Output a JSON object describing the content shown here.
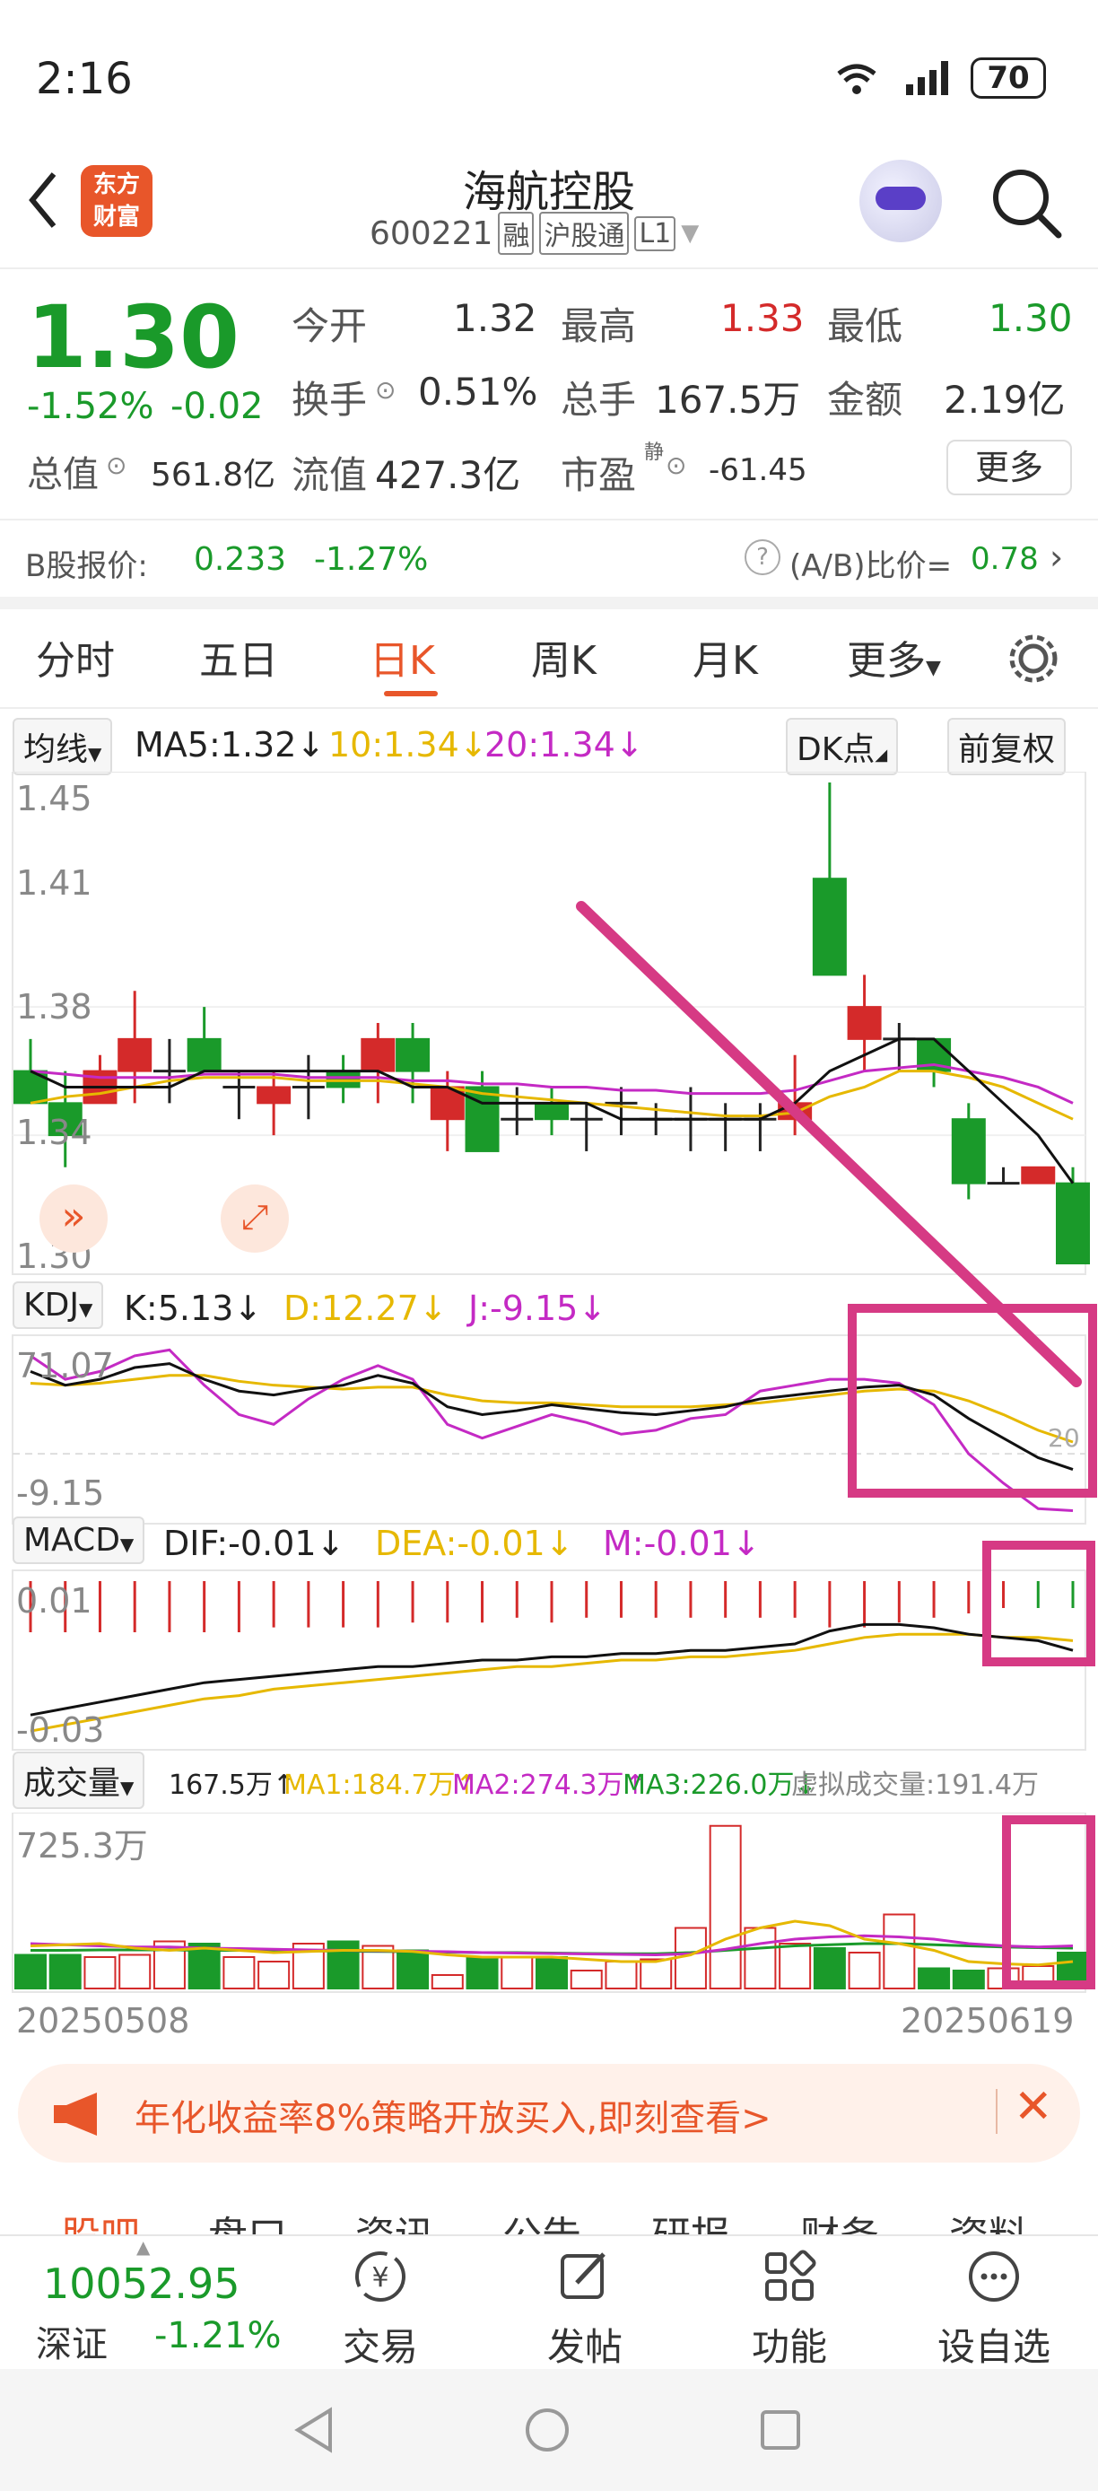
{
  "status_bar": {
    "time": "2:16",
    "battery": "70"
  },
  "header": {
    "back_icon": "chevron-left-icon",
    "app_logo_line1": "东方",
    "app_logo_line2": "财富",
    "stock_name": "海航控股",
    "stock_code": "600221",
    "badge_margin": "融",
    "badge_connect": "沪股通",
    "badge_level": "L1",
    "search_icon": "search-icon"
  },
  "quote": {
    "price": "1.30",
    "change_pct": "-1.52%",
    "change": "-0.02",
    "open_label": "今开",
    "open": "1.32",
    "high_label": "最高",
    "high": "1.33",
    "low_label": "最低",
    "low": "1.30",
    "turnover_label": "换手",
    "turnover": "0.51%",
    "volume_label": "总手",
    "volume": "167.5万",
    "amount_label": "金额",
    "amount": "2.19亿",
    "mktcap_label": "总值",
    "mktcap": "561.8亿",
    "float_label": "流值",
    "float": "427.3亿",
    "pe_label": "市盈",
    "pe_sup": "静",
    "pe": "-61.45",
    "more_label": "更多"
  },
  "b_share": {
    "label": "B股报价:",
    "price": "0.233",
    "change": "-1.27%",
    "ratio_label": "(A/B)比价=",
    "ratio": "0.78"
  },
  "tabs": [
    {
      "label": "分时"
    },
    {
      "label": "五日"
    },
    {
      "label": "日K"
    },
    {
      "label": "周K"
    },
    {
      "label": "月K"
    },
    {
      "label": "更多"
    }
  ],
  "ma_row": {
    "selector": "均线",
    "ma5": "MA5:1.32↓",
    "ma10": "10:1.34↓",
    "ma20": "20:1.34↓",
    "dk": "DK点",
    "adjust": "前复权"
  },
  "price_axis": {
    "top": "1.45",
    "l2": "1.41",
    "l3": "1.38",
    "l4": "1.34",
    "bottom": "1.30"
  },
  "kdj_row": {
    "selector": "KDJ",
    "k": "K:5.13↓",
    "d": "D:12.27↓",
    "j": "J:-9.15↓",
    "axis_top": "71.07",
    "axis_bottom": "-9.15",
    "level20": "20"
  },
  "macd_row": {
    "selector": "MACD",
    "dif": "DIF:-0.01↓",
    "dea": "DEA:-0.01↓",
    "m": "M:-0.01↓",
    "axis_top": "0.01",
    "axis_bottom": "-0.03"
  },
  "vol_row": {
    "selector": "成交量",
    "vol": "167.5万↑",
    "ma1": "MA1:184.7万↑",
    "ma2": "MA2:274.3万↑",
    "ma3": "MA3:226.0万↓",
    "virtual": "虚拟成交量:191.4万",
    "axis_top": "725.3万"
  },
  "dates": {
    "start": "20250508",
    "end": "20250619"
  },
  "banner": {
    "text": "年化收益率8%策略开放买入,即刻查看>"
  },
  "sub_tabs": [
    "股吧",
    "盘口",
    "资讯",
    "公告",
    "研报",
    "财务",
    "资料"
  ],
  "bottom_bar": {
    "index_value": "10052.95",
    "index_name": "深证",
    "index_change": "-1.21%",
    "items": [
      {
        "label": "交易"
      },
      {
        "label": "发帖"
      },
      {
        "label": "功能"
      },
      {
        "label": "设自选"
      }
    ]
  },
  "colors": {
    "up": "#d42a2a",
    "down": "#1a9a2a",
    "accent": "#e8562a",
    "annotation": "#d63a84",
    "ma5": "#111111",
    "ma10": "#e6b800",
    "ma20": "#c42ac4"
  },
  "chart_data": {
    "type": "candlestick",
    "price_candles": [
      {
        "o": 1.36,
        "c": 1.35,
        "h": 1.37,
        "l": 1.35
      },
      {
        "o": 1.35,
        "c": 1.34,
        "h": 1.36,
        "l": 1.33
      },
      {
        "o": 1.35,
        "c": 1.36,
        "h": 1.365,
        "l": 1.35
      },
      {
        "o": 1.36,
        "c": 1.37,
        "h": 1.385,
        "l": 1.35
      },
      {
        "o": 1.36,
        "c": 1.36,
        "h": 1.37,
        "l": 1.35
      },
      {
        "o": 1.37,
        "c": 1.36,
        "h": 1.38,
        "l": 1.36
      },
      {
        "o": 1.355,
        "c": 1.355,
        "h": 1.36,
        "l": 1.345
      },
      {
        "o": 1.35,
        "c": 1.355,
        "h": 1.36,
        "l": 1.34
      },
      {
        "o": 1.355,
        "c": 1.355,
        "h": 1.365,
        "l": 1.345
      },
      {
        "o": 1.36,
        "c": 1.355,
        "h": 1.365,
        "l": 1.35
      },
      {
        "o": 1.36,
        "c": 1.37,
        "h": 1.375,
        "l": 1.35
      },
      {
        "o": 1.37,
        "c": 1.36,
        "h": 1.375,
        "l": 1.35
      },
      {
        "o": 1.345,
        "c": 1.355,
        "h": 1.36,
        "l": 1.335
      },
      {
        "o": 1.355,
        "c": 1.335,
        "h": 1.36,
        "l": 1.335
      },
      {
        "o": 1.345,
        "c": 1.345,
        "h": 1.355,
        "l": 1.34
      },
      {
        "o": 1.35,
        "c": 1.345,
        "h": 1.355,
        "l": 1.34
      },
      {
        "o": 1.345,
        "c": 1.345,
        "h": 1.35,
        "l": 1.335
      },
      {
        "o": 1.35,
        "c": 1.35,
        "h": 1.355,
        "l": 1.34
      },
      {
        "o": 1.345,
        "c": 1.345,
        "h": 1.35,
        "l": 1.34
      },
      {
        "o": 1.345,
        "c": 1.345,
        "h": 1.355,
        "l": 1.335
      },
      {
        "o": 1.345,
        "c": 1.345,
        "h": 1.35,
        "l": 1.335
      },
      {
        "o": 1.345,
        "c": 1.345,
        "h": 1.35,
        "l": 1.335
      },
      {
        "o": 1.345,
        "c": 1.35,
        "h": 1.365,
        "l": 1.34
      },
      {
        "o": 1.42,
        "c": 1.39,
        "h": 1.45,
        "l": 1.39
      },
      {
        "o": 1.37,
        "c": 1.38,
        "h": 1.39,
        "l": 1.36
      },
      {
        "o": 1.37,
        "c": 1.37,
        "h": 1.375,
        "l": 1.36
      },
      {
        "o": 1.37,
        "c": 1.36,
        "h": 1.37,
        "l": 1.355
      },
      {
        "o": 1.345,
        "c": 1.325,
        "h": 1.35,
        "l": 1.32
      },
      {
        "o": 1.325,
        "c": 1.325,
        "h": 1.33,
        "l": 1.325
      },
      {
        "o": 1.325,
        "c": 1.33,
        "h": 1.33,
        "l": 1.325
      },
      {
        "o": 1.325,
        "c": 1.3,
        "h": 1.33,
        "l": 1.3
      }
    ],
    "ma5": [
      1.36,
      1.355,
      1.355,
      1.355,
      1.355,
      1.36,
      1.36,
      1.36,
      1.36,
      1.36,
      1.36,
      1.355,
      1.355,
      1.35,
      1.35,
      1.35,
      1.35,
      1.345,
      1.345,
      1.345,
      1.345,
      1.345,
      1.35,
      1.36,
      1.365,
      1.37,
      1.37,
      1.36,
      1.35,
      1.34,
      1.325
    ],
    "ma10": [
      1.35,
      1.352,
      1.353,
      1.355,
      1.357,
      1.358,
      1.358,
      1.358,
      1.357,
      1.357,
      1.357,
      1.356,
      1.355,
      1.353,
      1.352,
      1.351,
      1.35,
      1.349,
      1.348,
      1.347,
      1.346,
      1.346,
      1.347,
      1.352,
      1.355,
      1.36,
      1.36,
      1.358,
      1.355,
      1.35,
      1.345
    ],
    "ma20": [
      1.36,
      1.359,
      1.358,
      1.358,
      1.358,
      1.359,
      1.359,
      1.359,
      1.358,
      1.358,
      1.358,
      1.357,
      1.357,
      1.356,
      1.356,
      1.355,
      1.355,
      1.354,
      1.354,
      1.353,
      1.353,
      1.353,
      1.354,
      1.357,
      1.36,
      1.361,
      1.362,
      1.36,
      1.358,
      1.355,
      1.35
    ],
    "kdj_k": [
      62,
      55,
      58,
      64,
      66,
      58,
      52,
      50,
      53,
      55,
      60,
      56,
      44,
      40,
      42,
      45,
      43,
      41,
      40,
      42,
      44,
      48,
      50,
      52,
      54,
      55,
      50,
      38,
      28,
      18,
      12
    ],
    "kdj_d": [
      56,
      55,
      56,
      58,
      60,
      60,
      57,
      55,
      54,
      53,
      54,
      54,
      50,
      47,
      46,
      46,
      45,
      44,
      44,
      44,
      45,
      46,
      48,
      50,
      52,
      53,
      52,
      47,
      40,
      32,
      26
    ],
    "kdj_j": [
      70,
      58,
      62,
      70,
      73,
      55,
      40,
      35,
      48,
      58,
      65,
      58,
      35,
      28,
      34,
      40,
      36,
      30,
      32,
      38,
      40,
      52,
      55,
      58,
      58,
      56,
      45,
      20,
      5,
      -8,
      -9
    ],
    "macd_dif": [
      -0.03,
      -0.028,
      -0.026,
      -0.024,
      -0.022,
      -0.02,
      -0.019,
      -0.018,
      -0.017,
      -0.016,
      -0.015,
      -0.015,
      -0.014,
      -0.013,
      -0.013,
      -0.012,
      -0.012,
      -0.011,
      -0.011,
      -0.01,
      -0.01,
      -0.009,
      -0.008,
      -0.004,
      -0.002,
      -0.002,
      -0.003,
      -0.005,
      -0.006,
      -0.007,
      -0.01
    ],
    "macd_dea": [
      -0.035,
      -0.033,
      -0.031,
      -0.029,
      -0.027,
      -0.025,
      -0.024,
      -0.022,
      -0.021,
      -0.02,
      -0.019,
      -0.018,
      -0.017,
      -0.016,
      -0.015,
      -0.015,
      -0.014,
      -0.013,
      -0.013,
      -0.012,
      -0.012,
      -0.011,
      -0.01,
      -0.008,
      -0.006,
      -0.005,
      -0.005,
      -0.005,
      -0.006,
      -0.006,
      -0.007
    ],
    "volume": [
      150,
      150,
      140,
      150,
      210,
      200,
      140,
      120,
      200,
      210,
      190,
      170,
      60,
      140,
      140,
      140,
      80,
      120,
      130,
      270,
      725,
      270,
      200,
      180,
      160,
      330,
      90,
      80,
      90,
      100,
      160
    ],
    "volume_ma1": [
      190,
      195,
      200,
      180,
      170,
      180,
      170,
      160,
      165,
      170,
      170,
      165,
      150,
      140,
      140,
      140,
      130,
      120,
      120,
      150,
      220,
      270,
      300,
      280,
      220,
      200,
      170,
      120,
      110,
      105,
      120
    ],
    "volume_ma2": [
      200,
      195,
      190,
      185,
      185,
      180,
      178,
      175,
      172,
      170,
      168,
      166,
      164,
      160,
      158,
      156,
      154,
      152,
      150,
      155,
      175,
      200,
      220,
      230,
      235,
      230,
      220,
      200,
      190,
      185,
      190
    ],
    "volume_ma3": [
      170,
      170,
      172,
      172,
      172,
      170,
      170,
      168,
      168,
      166,
      165,
      164,
      162,
      160,
      160,
      158,
      156,
      155,
      155,
      160,
      170,
      180,
      190,
      195,
      200,
      200,
      195,
      190,
      185,
      182,
      180
    ]
  }
}
